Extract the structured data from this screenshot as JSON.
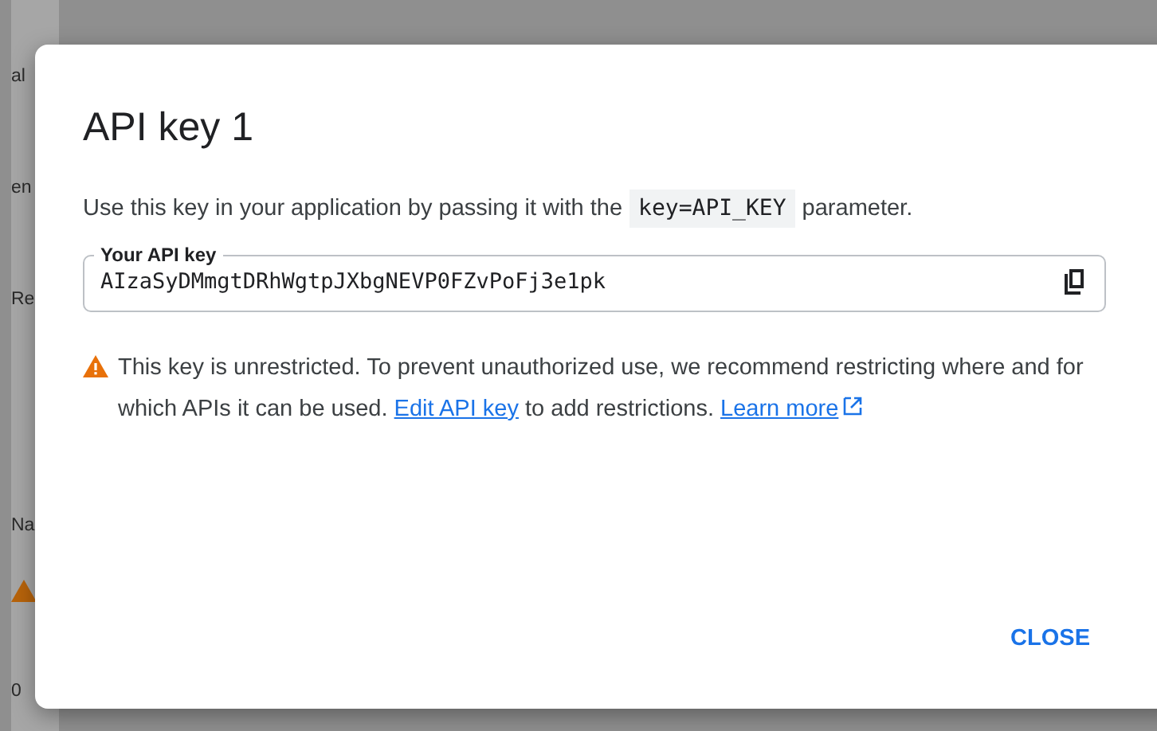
{
  "background": {
    "fragments": [
      {
        "kind": "text",
        "text": "al"
      },
      {
        "kind": "text",
        "text": "en"
      },
      {
        "kind": "text",
        "text": "Re"
      },
      {
        "kind": "text",
        "text": "Na"
      },
      {
        "kind": "warning"
      },
      {
        "kind": "text",
        "text": "0"
      }
    ]
  },
  "dialog": {
    "title": "API key 1",
    "intro": {
      "before": "Use this key in your application by passing it with the",
      "code": "key=API_KEY",
      "after": "parameter."
    },
    "key_field": {
      "label": "Your API key",
      "value": "AIzaSyDMmgtDRhWgtpJXbgNEVP0FZvPoFj3e1pk"
    },
    "warning": {
      "text": "This key is unrestricted. To prevent unauthorized use, we recommend restricting where and for which APIs it can be used.",
      "edit_link": "Edit API key",
      "middle": "to add restrictions.",
      "learn_link": "Learn more"
    },
    "buttons": [
      "CLOSE"
    ]
  }
}
